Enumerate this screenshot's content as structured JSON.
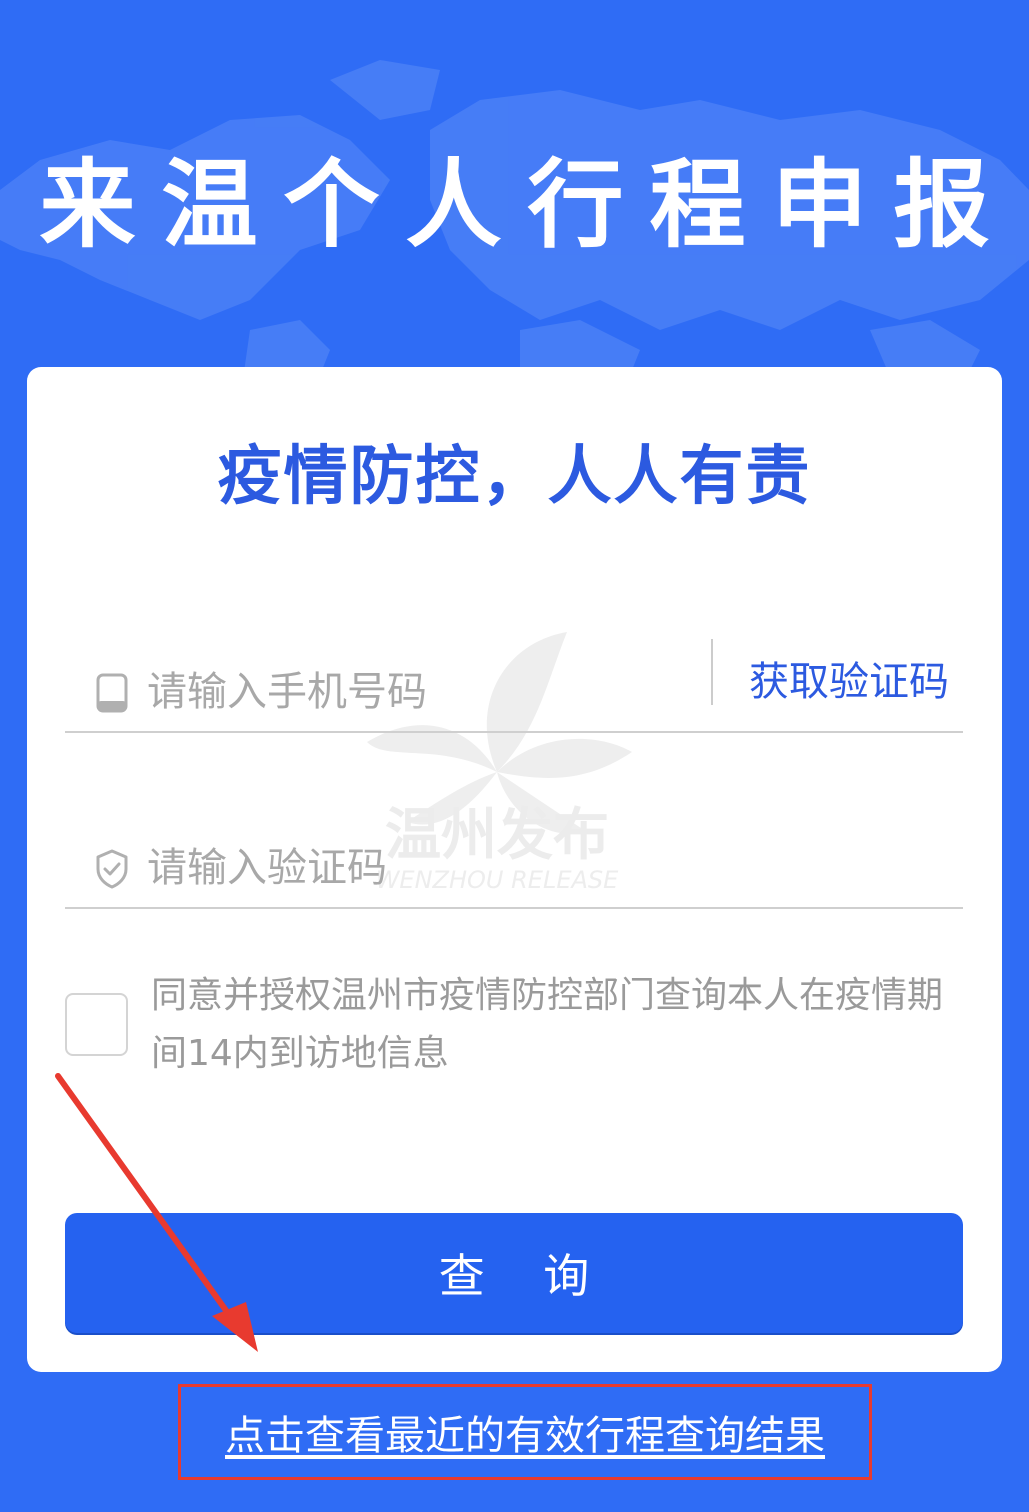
{
  "header": {
    "title": "来温个人行程申报"
  },
  "card": {
    "slogan": "疫情防控，人人有责",
    "phone": {
      "placeholder": "请输入手机号码",
      "get_code_label": "获取验证码"
    },
    "code": {
      "placeholder": "请输入验证码"
    },
    "agreement": {
      "text": "同意并授权温州市疫情防控部门查询本人在疫情期间14内到访地信息",
      "checked": false
    },
    "query_label": "查 询"
  },
  "watermark": {
    "text": "温州发布",
    "subtext": "WENZHOU RELEASE"
  },
  "result_link": {
    "label": "点击查看最近的有效行程查询结果"
  },
  "colors": {
    "background": "#2f6cf5",
    "accent": "#2c5ae0",
    "button": "#2562f0",
    "annotation": "#e83a2f"
  }
}
